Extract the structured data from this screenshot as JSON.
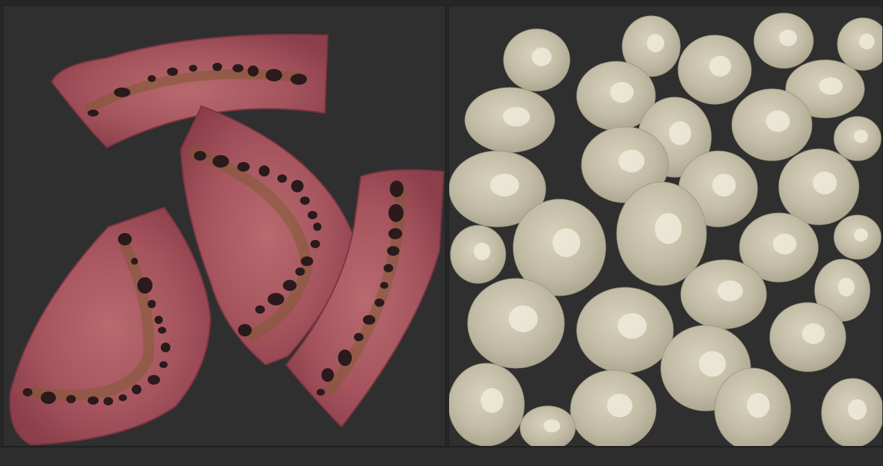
{
  "viewer": {
    "background_color": "#2b2b2b",
    "panel_color": "#2f2f2f"
  },
  "panels": [
    {
      "content": "uv-layout-flesh-slices",
      "texture_color": "#9c4c57",
      "accent_color": "#8a6a3a"
    },
    {
      "content": "uv-layout-seed-islands",
      "texture_color": "#c4bea8",
      "highlight_color": "#f0ecdc"
    }
  ]
}
